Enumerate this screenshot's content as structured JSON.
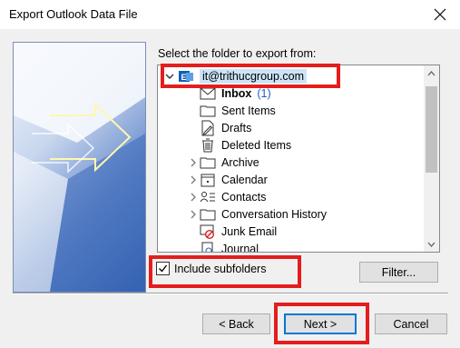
{
  "window": {
    "title": "Export Outlook Data File"
  },
  "main": {
    "prompt": "Select the folder to export from:",
    "include_subfolders_label": "Include subfolders",
    "include_subfolders_checked": true,
    "filter_button": "Filter..."
  },
  "tree": {
    "account": {
      "label": "it@trithucgroup.com",
      "icon": "exchange-account-icon",
      "expanded": true
    },
    "folders": [
      {
        "label": "Inbox",
        "icon": "mail-icon",
        "bold": true,
        "count": "(1)",
        "expandable": false
      },
      {
        "label": "Sent Items",
        "icon": "folder-icon",
        "expandable": false
      },
      {
        "label": "Drafts",
        "icon": "drafts-icon",
        "expandable": false
      },
      {
        "label": "Deleted Items",
        "icon": "trash-icon",
        "expandable": false
      },
      {
        "label": "Archive",
        "icon": "folder-icon",
        "expandable": true
      },
      {
        "label": "Calendar",
        "icon": "calendar-icon",
        "expandable": true
      },
      {
        "label": "Contacts",
        "icon": "contacts-icon",
        "expandable": true
      },
      {
        "label": "Conversation History",
        "icon": "folder-icon",
        "expandable": true
      },
      {
        "label": "Junk Email",
        "icon": "junk-icon",
        "expandable": false
      },
      {
        "label": "Journal",
        "icon": "journal-icon",
        "expandable": false
      }
    ]
  },
  "footer": {
    "back_button": "< Back",
    "next_button": "Next >",
    "cancel_button": "Cancel"
  },
  "colors": {
    "highlight": "#e41d1d",
    "selection": "#cce4f7",
    "accent": "#0078d7"
  }
}
